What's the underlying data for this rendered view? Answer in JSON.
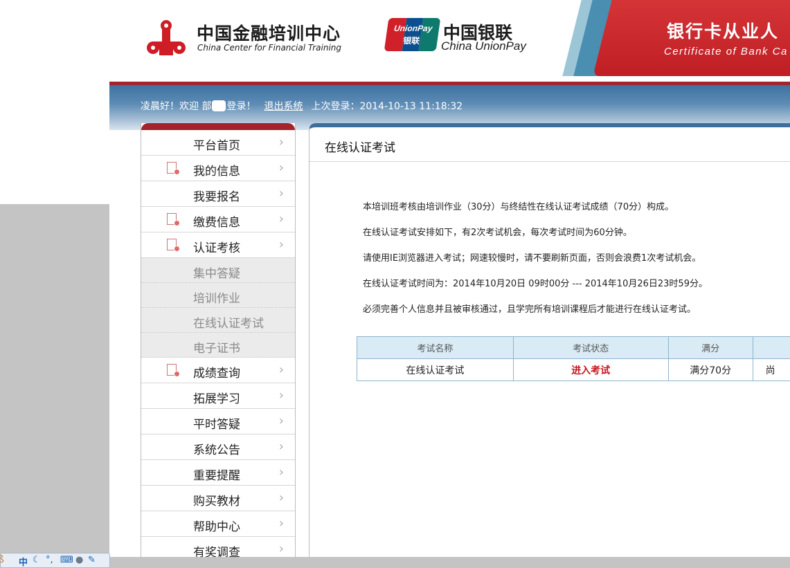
{
  "header": {
    "org_name_cn": "中国金融培训中心",
    "org_name_en": "China Center for Financial Training",
    "unionpay_badge_en": "UnionPay",
    "unionpay_badge_cn": "银联",
    "unionpay_name_cn": "中国银联",
    "unionpay_name_en": "China UnionPay",
    "banner_title": "银行卡从业人",
    "banner_subtitle": "Certificate of Bank Ca"
  },
  "welcome": {
    "greeting_prefix": "凌晨好！欢迎",
    "user_fragment": "部",
    "greeting_suffix": "登录！",
    "logout": "退出系统",
    "last_login": "上次登录：2014-10-13 11:18:32"
  },
  "sidebar": {
    "items_top": [
      {
        "label": "平台首页",
        "doc_icon": false
      },
      {
        "label": "我的信息",
        "doc_icon": true
      },
      {
        "label": "我要报名",
        "doc_icon": false
      },
      {
        "label": "缴费信息",
        "doc_icon": true
      },
      {
        "label": "认证考核",
        "doc_icon": true
      }
    ],
    "sub_items": [
      {
        "label": "集中答疑"
      },
      {
        "label": "培训作业"
      },
      {
        "label": "在线认证考试"
      },
      {
        "label": "电子证书"
      }
    ],
    "items_bottom": [
      {
        "label": "成绩查询",
        "doc_icon": true
      },
      {
        "label": "拓展学习",
        "doc_icon": false
      },
      {
        "label": "平时答疑",
        "doc_icon": false
      },
      {
        "label": "系统公告",
        "doc_icon": false
      },
      {
        "label": "重要提醒",
        "doc_icon": false
      },
      {
        "label": "购买教材",
        "doc_icon": false
      },
      {
        "label": "帮助中心",
        "doc_icon": false
      },
      {
        "label": "有奖调查",
        "doc_icon": false
      }
    ]
  },
  "main": {
    "title": "在线认证考试",
    "notes": [
      "本培训班考核由培训作业（30分）与终结性在线认证考试成绩（70分）构成。",
      "在线认证考试安排如下，有2次考试机会，每次考试时间为60分钟。",
      "请使用IE浏览器进入考试；网速较慢时，请不要刷新页面，否则会浪费1次考试机会。",
      "在线认证考试时间为：2014年10月20日 09时00分 --- 2014年10月26日23时59分。",
      "必须完善个人信息并且被审核通过，且学完所有培训课程后才能进行在线认证考试。"
    ],
    "table": {
      "headers": [
        "考试名称",
        "考试状态",
        "满分",
        ""
      ],
      "row": [
        "在线认证考试",
        "进入考试",
        "满分70分",
        "尚"
      ]
    }
  },
  "ime": {
    "mode": "中",
    "punct": "°,"
  },
  "colors": {
    "brand_red": "#a3252b",
    "nav_blue": "#3e6f9b",
    "enter_red": "#c8161d"
  }
}
